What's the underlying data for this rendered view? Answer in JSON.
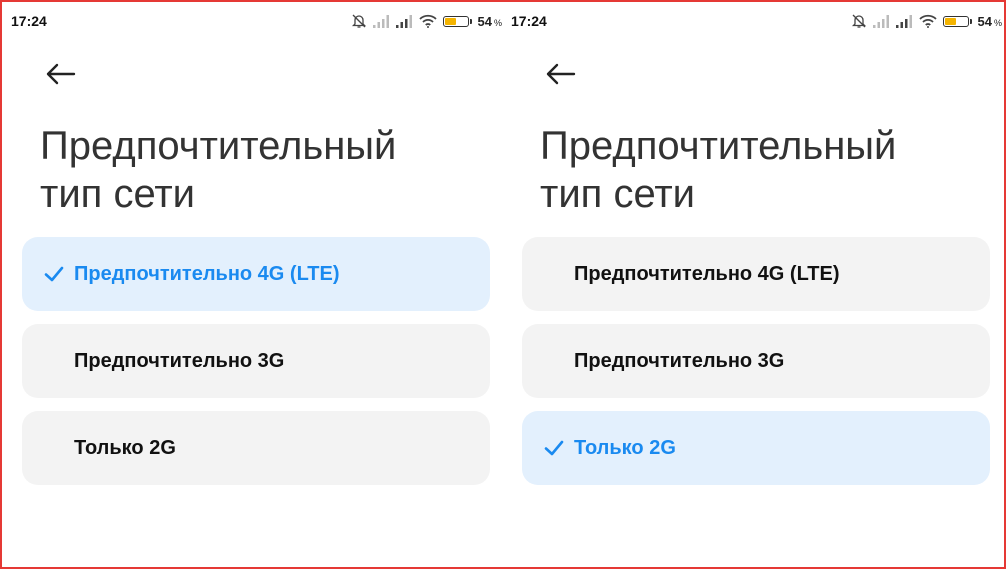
{
  "panels": [
    {
      "status": {
        "time": "17:24",
        "battery_percent": "54",
        "percent_sign": "%",
        "battery_level": 0.54
      },
      "title_lines": [
        "Предпочтительный",
        "тип сети"
      ],
      "options": [
        {
          "label": "Предпочтительно 4G (LTE)",
          "selected": true
        },
        {
          "label": "Предпочтительно 3G",
          "selected": false
        },
        {
          "label": "Только 2G",
          "selected": false
        }
      ]
    },
    {
      "status": {
        "time": "17:24",
        "battery_percent": "54",
        "percent_sign": "%",
        "battery_level": 0.54
      },
      "title_lines": [
        "Предпочтительный",
        "тип сети"
      ],
      "options": [
        {
          "label": "Предпочтительно 4G (LTE)",
          "selected": false
        },
        {
          "label": "Предпочтительно 3G",
          "selected": false
        },
        {
          "label": "Только 2G",
          "selected": true
        }
      ]
    }
  ],
  "icons": {
    "back": "arrow-left-icon",
    "silent": "bell-off-icon",
    "signal": "cell-signal-icon",
    "wifi": "wifi-icon",
    "battery": "battery-icon",
    "check": "checkmark-icon"
  },
  "colors": {
    "accent": "#1a8af0",
    "selected_bg": "#e3f0fd",
    "option_bg": "#f3f3f3",
    "battery": "#f4b400",
    "frame_border": "#e53935"
  }
}
